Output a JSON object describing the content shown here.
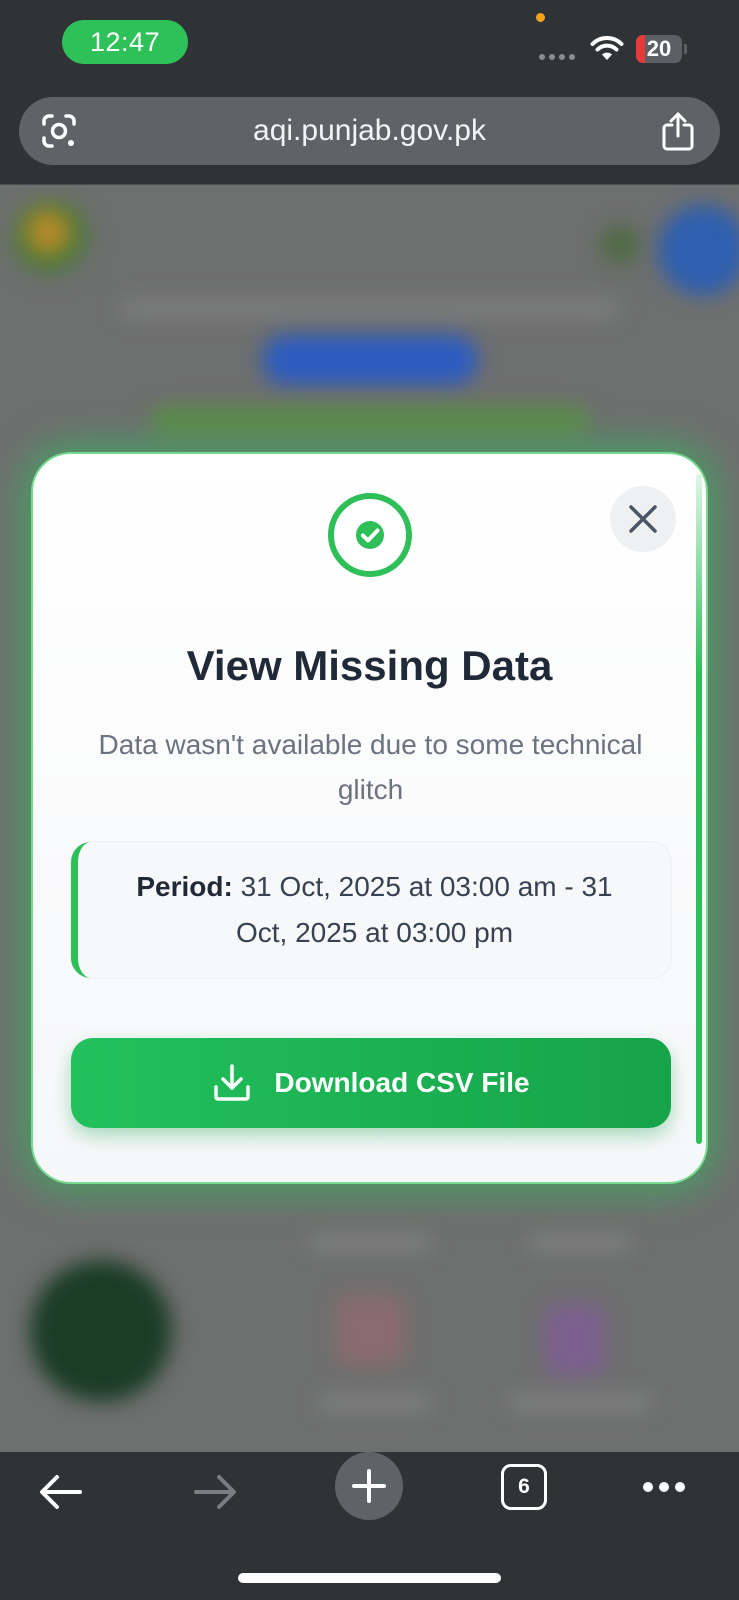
{
  "status_bar": {
    "time": "12:47",
    "battery_level": "20",
    "battery_fraction": 0.2,
    "colors": {
      "time_pill": "#2ec15a",
      "battery_low": "#e5393a"
    },
    "icons": [
      "orange-dot-indicator",
      "signal-dots-icon",
      "wifi-icon",
      "battery-icon"
    ]
  },
  "browser": {
    "url": "aqi.punjab.gov.pk",
    "icons": [
      "google-lens-icon",
      "share-icon"
    ]
  },
  "modal": {
    "title": "View Missing Data",
    "description": "Data wasn't available due to some technical glitch",
    "period_label": "Period:",
    "period_value": "31 Oct, 2025 at 03:00 am - 31 Oct, 2025 at 03:00 pm",
    "download_label": "Download CSV File",
    "icons": [
      "check-circle-icon",
      "close-icon",
      "download-icon"
    ],
    "colors": {
      "accent": "#2ebf58",
      "title": "#1f2937",
      "text": "#6b7280"
    }
  },
  "toolbar": {
    "tab_count": "6",
    "icons": [
      "back-arrow-icon",
      "forward-arrow-icon",
      "plus-icon",
      "tabs-icon",
      "more-icon"
    ]
  }
}
